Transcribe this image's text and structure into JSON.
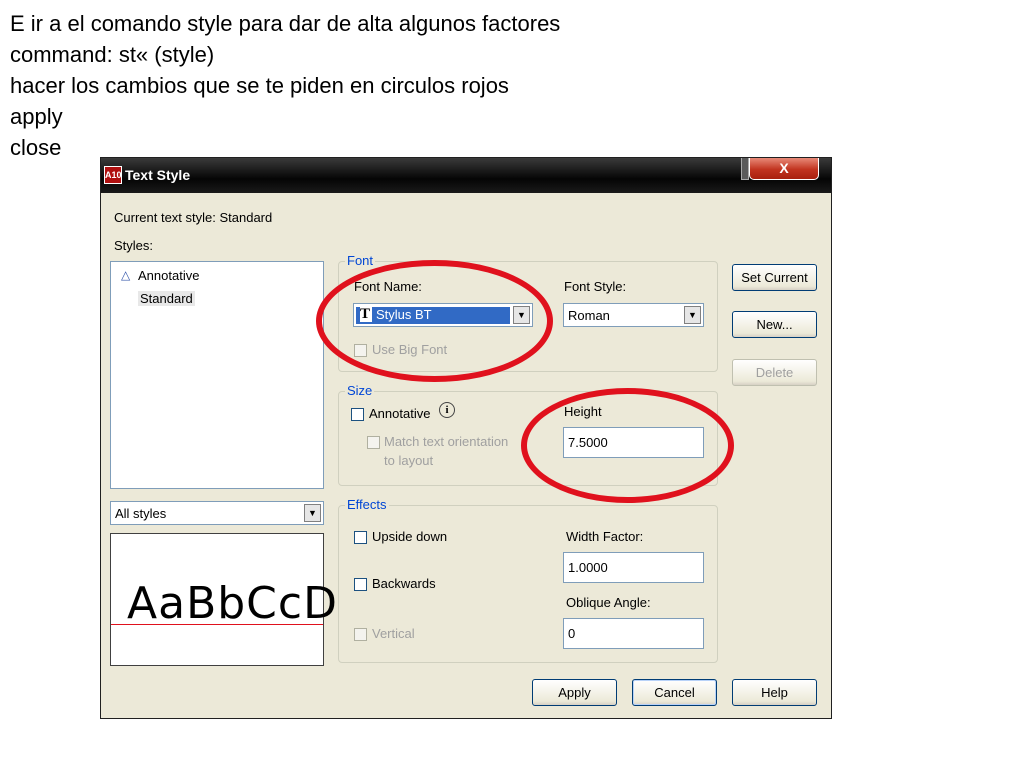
{
  "instructions": [
    "E ir a el comando style para dar de alta algunos factores",
    "command: st« (style)",
    "hacer los cambios que se te piden en circulos rojos",
    "apply",
    "close"
  ],
  "dialog": {
    "title": "Text Style",
    "app_icon_text": "A10",
    "close_glyph": "X",
    "current_style_label": "Current text style:  Standard",
    "styles_label": "Styles:",
    "styles_list": [
      "Annotative",
      "Standard"
    ],
    "filter_value": "All styles",
    "preview_text": "AaBbCcD",
    "font": {
      "group_title": "Font",
      "font_name_label": "Font Name:",
      "font_name_value": "Stylus BT",
      "font_style_label": "Font Style:",
      "font_style_value": "Roman",
      "big_font_label": "Use Big Font"
    },
    "size": {
      "group_title": "Size",
      "annotative_label": "Annotative",
      "match_label_1": "Match text orientation",
      "match_label_2": "to layout",
      "height_label": "Height",
      "height_value": "7.5000"
    },
    "effects": {
      "group_title": "Effects",
      "upside_down_label": "Upside down",
      "backwards_label": "Backwards",
      "vertical_label": "Vertical",
      "width_factor_label": "Width Factor:",
      "width_factor_value": "1.0000",
      "oblique_label": "Oblique Angle:",
      "oblique_value": "0"
    },
    "buttons": {
      "set_current": "Set Current",
      "new": "New...",
      "delete": "Delete",
      "apply": "Apply",
      "cancel": "Cancel",
      "help": "Help"
    }
  },
  "colors": {
    "annotation_ring": "#e0111d",
    "dialog_bg": "#ece9d8",
    "selection": "#316ac5"
  }
}
